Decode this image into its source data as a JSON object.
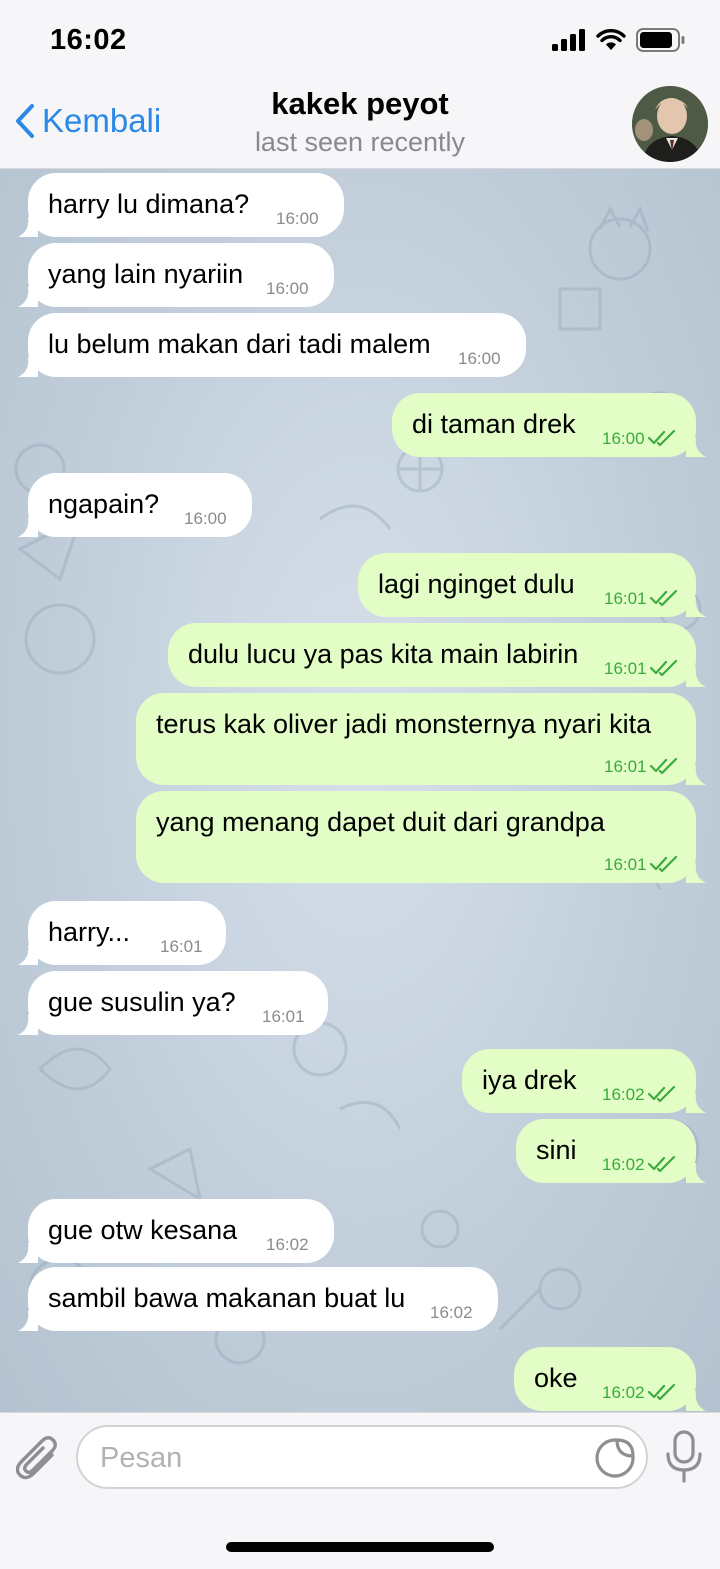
{
  "status": {
    "time": "16:02"
  },
  "header": {
    "back_label": "Kembali",
    "title": "kakek peyot",
    "subtitle": "last seen recently"
  },
  "messages": [
    {
      "dir": "in",
      "text": "harry lu dimana?",
      "time": "16:00"
    },
    {
      "dir": "in",
      "text": "yang lain nyariin",
      "time": "16:00"
    },
    {
      "dir": "in",
      "text": "lu belum makan dari tadi malem",
      "time": "16:00"
    },
    {
      "dir": "out",
      "text": "di taman drek",
      "time": "16:00"
    },
    {
      "dir": "in",
      "text": "ngapain?",
      "time": "16:00"
    },
    {
      "dir": "out",
      "text": "lagi nginget dulu",
      "time": "16:01"
    },
    {
      "dir": "out",
      "text": "dulu lucu ya pas kita main labirin",
      "time": "16:01"
    },
    {
      "dir": "out",
      "text": "terus kak oliver jadi monsternya nyari kita",
      "time": "16:01"
    },
    {
      "dir": "out",
      "text": "yang menang dapet duit dari grandpa",
      "time": "16:01"
    },
    {
      "dir": "in",
      "text": "harry...",
      "time": "16:01"
    },
    {
      "dir": "in",
      "text": "gue susulin ya?",
      "time": "16:01"
    },
    {
      "dir": "out",
      "text": "iya drek",
      "time": "16:02"
    },
    {
      "dir": "out",
      "text": "sini",
      "time": "16:02"
    },
    {
      "dir": "in",
      "text": "gue otw kesana",
      "time": "16:02"
    },
    {
      "dir": "in",
      "text": "sambil bawa makanan buat lu",
      "time": "16:02"
    },
    {
      "dir": "out",
      "text": "oke",
      "time": "16:02"
    }
  ],
  "composer": {
    "placeholder": "Pesan"
  },
  "colors": {
    "accent": "#2a89e6",
    "outgoing_bubble": "#e2fdc6",
    "incoming_bubble": "#ffffff",
    "read_check": "#3bab3e"
  },
  "icons": {
    "back": "chevron-left-icon",
    "attach": "paperclip-icon",
    "sticker": "sticker-icon",
    "mic": "microphone-icon"
  }
}
